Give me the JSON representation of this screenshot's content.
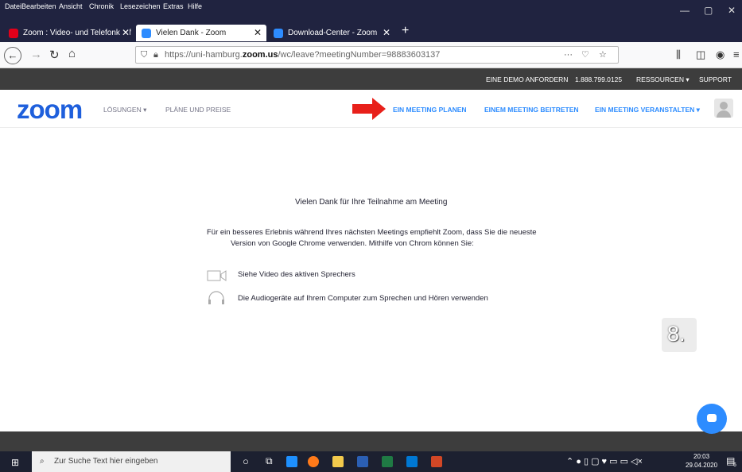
{
  "menu": [
    "Datei",
    "Bearbeiten",
    "Ansicht",
    "Chronik",
    "Lesezeichen",
    "Extras",
    "Hilfe"
  ],
  "tabs": [
    {
      "title": "Zoom : Video- und Telefonkonf",
      "active": false,
      "icon": "uhh-icon"
    },
    {
      "title": "Vielen Dank - Zoom",
      "active": true,
      "icon": "zoom-icon"
    },
    {
      "title": "Download-Center - Zoom",
      "active": false,
      "icon": "zoom-icon"
    }
  ],
  "new_tab": "+",
  "url": {
    "prefix": "https://uni-hamburg.",
    "domain": "zoom.us",
    "path": "/wc/leave?meetingNumber=98883603137"
  },
  "topstrip": {
    "demo": "EINE DEMO ANFORDERN",
    "phone": "1.888.799.0125",
    "resources": "RESSOURCEN ▾",
    "support": "SUPPORT"
  },
  "zoom_nav": {
    "logo": "zoom",
    "solutions": "LÖSUNGEN ▾",
    "plans": "PLÄNE UND PREISE",
    "schedule": "EIN MEETING PLANEN",
    "join": "EINEM MEETING BEITRETEN",
    "host": "EIN MEETING VERANSTALTEN ▾"
  },
  "content": {
    "thanks": "Vielen Dank für Ihre Teilnahme am Meeting",
    "recommend_1": "Für ein besseres Erlebnis während Ihres nächsten Meetings empfiehlt Zoom, dass Sie die neueste",
    "recommend_2": "Version von Google Chrome verwenden. Mithilfe von Chrom können Sie:",
    "feature_video": "Siehe Video des aktiven Sprechers",
    "feature_audio": "Die Audiogeräte auf Ihrem Computer zum Sprechen und Hören verwenden"
  },
  "step_badge": "8.",
  "taskbar": {
    "search_placeholder": "Zur Suche Text hier eingeben",
    "time": "20:03",
    "date": "29.04.2020",
    "notif_count": "6"
  },
  "colors": {
    "accent": "#2d8cff",
    "arrow": "#e8201a",
    "tabbar": "#202340"
  }
}
